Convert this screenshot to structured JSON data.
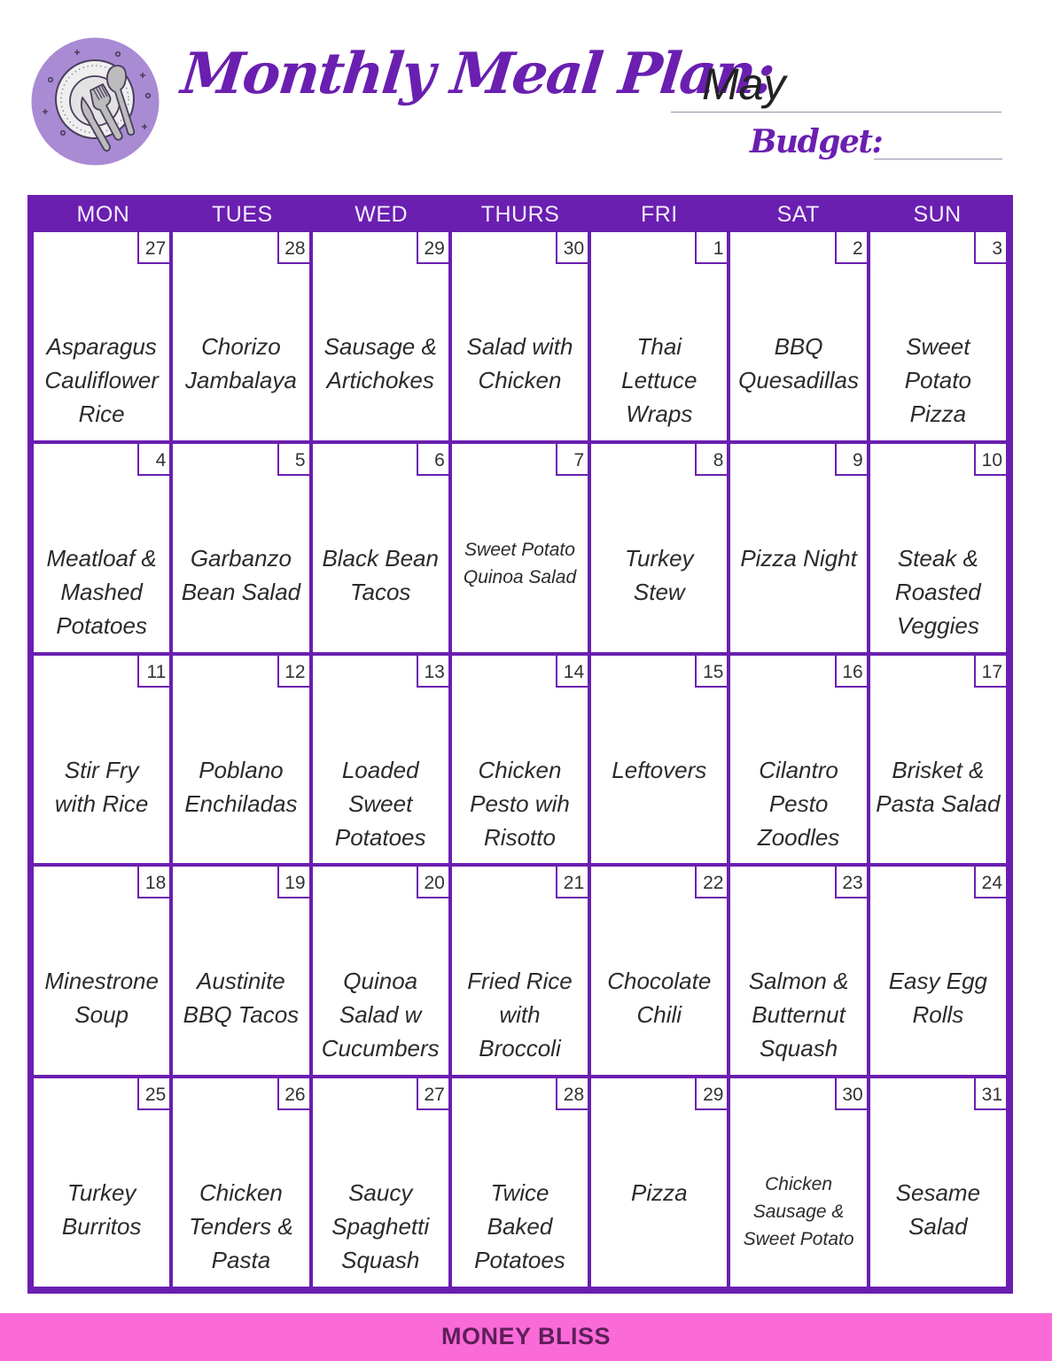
{
  "header": {
    "title": "Monthly Meal Plan:",
    "month": "May",
    "budget_label": "Budget:",
    "budget_value": "",
    "logo_icon": "plate-cutlery-icon"
  },
  "colors": {
    "accent": "#6a1fb0",
    "logo_bg": "#a98bd4",
    "footer_bg": "#fa6bd8",
    "footer_text": "#5e1f5a"
  },
  "calendar": {
    "days": [
      "MON",
      "TUES",
      "WED",
      "THURS",
      "FRI",
      "SAT",
      "SUN"
    ],
    "weeks": [
      [
        {
          "date": "27",
          "meal": "Asparagus Cauliflower Rice"
        },
        {
          "date": "28",
          "meal": "Chorizo Jambalaya"
        },
        {
          "date": "29",
          "meal": "Sausage & Artichokes"
        },
        {
          "date": "30",
          "meal": "Salad with Chicken"
        },
        {
          "date": "1",
          "meal": "Thai Lettuce Wraps"
        },
        {
          "date": "2",
          "meal": "BBQ Quesadillas"
        },
        {
          "date": "3",
          "meal": "Sweet Potato Pizza"
        }
      ],
      [
        {
          "date": "4",
          "meal": "Meatloaf & Mashed Potatoes"
        },
        {
          "date": "5",
          "meal": "Garbanzo Bean Salad"
        },
        {
          "date": "6",
          "meal": "Black Bean Tacos"
        },
        {
          "date": "7",
          "meal": "Sweet Potato Quinoa Salad"
        },
        {
          "date": "8",
          "meal": "Turkey Stew"
        },
        {
          "date": "9",
          "meal": "Pizza Night"
        },
        {
          "date": "10",
          "meal": "Steak & Roasted Veggies"
        }
      ],
      [
        {
          "date": "11",
          "meal": "Stir Fry with Rice"
        },
        {
          "date": "12",
          "meal": "Poblano Enchiladas"
        },
        {
          "date": "13",
          "meal": "Loaded Sweet Potatoes"
        },
        {
          "date": "14",
          "meal": "Chicken Pesto wih Risotto"
        },
        {
          "date": "15",
          "meal": "Leftovers"
        },
        {
          "date": "16",
          "meal": "Cilantro Pesto Zoodles"
        },
        {
          "date": "17",
          "meal": "Brisket & Pasta Salad"
        }
      ],
      [
        {
          "date": "18",
          "meal": "Minestrone Soup"
        },
        {
          "date": "19",
          "meal": "Austinite BBQ Tacos"
        },
        {
          "date": "20",
          "meal": "Quinoa Salad w Cucumbers"
        },
        {
          "date": "21",
          "meal": "Fried Rice with Broccoli"
        },
        {
          "date": "22",
          "meal": "Chocolate Chili"
        },
        {
          "date": "23",
          "meal": "Salmon & Butternut Squash"
        },
        {
          "date": "24",
          "meal": "Easy Egg Rolls"
        }
      ],
      [
        {
          "date": "25",
          "meal": "Turkey Burritos"
        },
        {
          "date": "26",
          "meal": "Chicken Tenders & Pasta"
        },
        {
          "date": "27",
          "meal": "Saucy Spaghetti Squash"
        },
        {
          "date": "28",
          "meal": "Twice Baked Potatoes"
        },
        {
          "date": "29",
          "meal": "Pizza"
        },
        {
          "date": "30",
          "meal": "Chicken Sausage & Sweet Potato"
        },
        {
          "date": "31",
          "meal": "Sesame Salad"
        }
      ]
    ]
  },
  "footer": {
    "brand": "MONEY BLISS"
  }
}
